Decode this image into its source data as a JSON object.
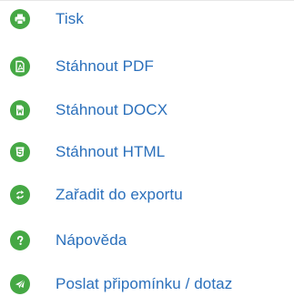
{
  "theme": {
    "icon_color": "#45a844",
    "text_color": "#2a6fbb"
  },
  "menu": {
    "items": [
      {
        "label": "Tisk",
        "icon": "printer-icon"
      },
      {
        "label": "Stáhnout PDF",
        "icon": "pdf-file-icon"
      },
      {
        "label": "Stáhnout DOCX",
        "icon": "word-file-icon"
      },
      {
        "label": "Stáhnout HTML",
        "icon": "html5-icon"
      },
      {
        "label": "Zařadit do exportu",
        "icon": "export-arrows-icon"
      },
      {
        "label": "Nápověda",
        "icon": "help-question-icon"
      },
      {
        "label": "Poslat připomínku / dotaz",
        "icon": "send-paper-plane-icon"
      }
    ]
  }
}
